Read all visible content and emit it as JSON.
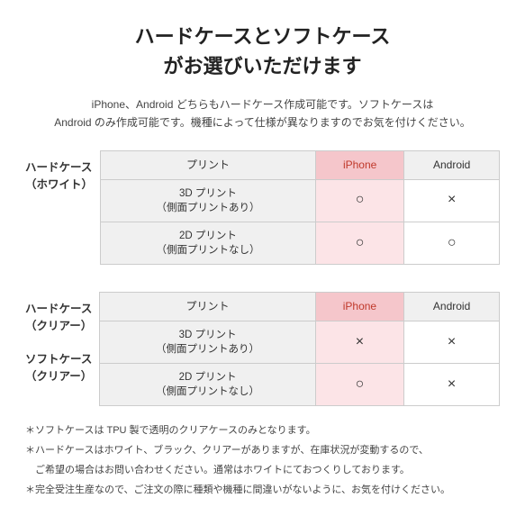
{
  "title": {
    "line1": "ハードケースとソフトケース",
    "line2": "がお選びいただけます"
  },
  "subtitle": "iPhone、Android どちらもハードケース作成可能です。ソフトケースは\nAndroid のみ作成可能です。機種によって仕様が異なりますのでお気を付けください。",
  "table1": {
    "row_label_line1": "ハードケース",
    "row_label_line2": "（ホワイト）",
    "header_print": "プリント",
    "header_iphone": "iPhone",
    "header_android": "Android",
    "rows": [
      {
        "print": "3D プリント\n（側面プリントあり）",
        "iphone": "○",
        "android": "×"
      },
      {
        "print": "2D プリント\n（側面プリントなし）",
        "iphone": "○",
        "android": "○"
      }
    ]
  },
  "table2": {
    "row_label_line1": "ハードケース",
    "row_label_line2": "（クリアー）",
    "row_label_line3": "ソフトケース",
    "row_label_line4": "（クリアー）",
    "header_print": "プリント",
    "header_iphone": "iPhone",
    "header_android": "Android",
    "rows": [
      {
        "print": "3D プリント\n（側面プリントあり）",
        "iphone": "×",
        "android": "×"
      },
      {
        "print": "2D プリント\n（側面プリントなし）",
        "iphone": "○",
        "android": "×"
      }
    ]
  },
  "footer": {
    "notes": [
      "＊ソフトケースは TPU 製で透明のクリアケースのみとなります。",
      "＊ハードケースはホワイト、ブラック、クリアーがありますが、在庫状況が変動するので、",
      "　ご希望の場合はお問い合わせください。通常はホワイトにておつくりしております。",
      "＊完全受注生産なので、ご注文の際に種類や機種に間違いがないように、お気を付けください。"
    ]
  }
}
